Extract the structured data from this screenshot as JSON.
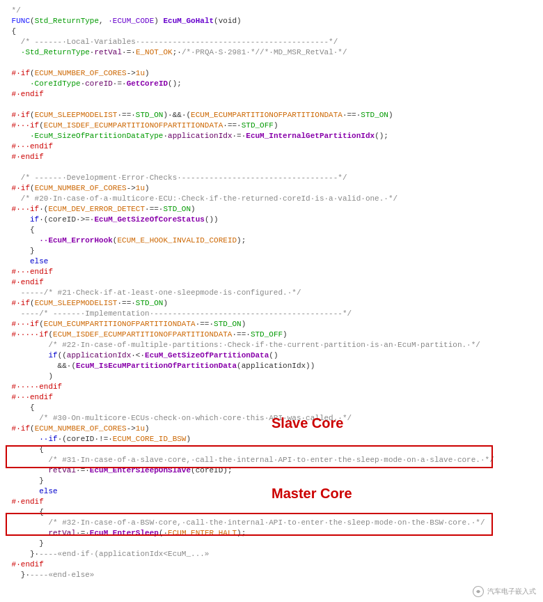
{
  "code": {
    "lines": [
      {
        "id": 1,
        "text": " */"
      },
      {
        "id": 2,
        "text": " FUNC(Std_ReturnType, ECUM_CODE) EcuM_GoHalt(void)"
      },
      {
        "id": 3,
        "text": " {"
      },
      {
        "id": 4,
        "text": "   /* ------ Local Variables ----------------------------------------*/"
      },
      {
        "id": 5,
        "text": "   Std_ReturnType retVal = E_NOT_OK; /*PRQA S 2981 *//*MD_MSR_RetVal */"
      },
      {
        "id": 6,
        "text": ""
      },
      {
        "id": 7,
        "text": " # if(ECUM_NUMBER_OF_CORES->1u)"
      },
      {
        "id": 8,
        "text": "     CoreIdType coreID = GetCoreID();"
      },
      {
        "id": 9,
        "text": " # endif"
      },
      {
        "id": 10,
        "text": ""
      },
      {
        "id": 11,
        "text": " # if(ECUM_SLEEPMODELIST == STD_ON) && (ECUM_ECUMPARTITIONOFPARTITIONDATA == STD_ON)"
      },
      {
        "id": 12,
        "text": " #   if(ECUM_ISDEF_ECUMPARTITIONOFPARTITIONDATA == STD_OFF)"
      },
      {
        "id": 13,
        "text": "       EcuM_SizeOfPartitionDataType applicationIdx = EcuM_InternalGetPartitionIdx();"
      },
      {
        "id": 14,
        "text": " #   endif"
      },
      {
        "id": 15,
        "text": " # endif"
      },
      {
        "id": 16,
        "text": ""
      },
      {
        "id": 17,
        "text": "   /* ------ Development Error Checks ---------------------------------*/"
      },
      {
        "id": 18,
        "text": " # if(ECUM_NUMBER_OF_CORES->1u)"
      },
      {
        "id": 19,
        "text": "   /* #20 In case of a multicore ECU: Check if the returned coreId is a valid one. */"
      },
      {
        "id": 20,
        "text": " #   if (ECUM_DEV_ERROR_DETECT == STD_ON)"
      },
      {
        "id": 21,
        "text": "     if (coreID >= EcuM_GetSizeOfCoreStatus())"
      },
      {
        "id": 22,
        "text": "     {"
      },
      {
        "id": 23,
        "text": "       EcuM_ErrorHook(ECUM_E_HOOK_INVALID_COREID);"
      },
      {
        "id": 24,
        "text": "     }"
      },
      {
        "id": 25,
        "text": "     else"
      },
      {
        "id": 26,
        "text": " #   endif"
      },
      {
        "id": 27,
        "text": " # endif"
      },
      {
        "id": 28,
        "text": "   -----/* #21 Check if at least one sleepmode is configured. */"
      },
      {
        "id": 29,
        "text": " # if(ECUM_SLEEPMODELIST == STD_ON)"
      },
      {
        "id": 30,
        "text": "   ----/* ------ Implementation -----------------------------------------*/"
      },
      {
        "id": 31,
        "text": " #   if(ECUM_ECUMPARTITIONOFPARTITIONDATA == STD_ON)"
      },
      {
        "id": 32,
        "text": " #     if(ECUM_ISDEF_ECUMPARTITIONOFPARTITIONDATA == STD_OFF)"
      },
      {
        "id": 33,
        "text": "         /* #22 In case of multiple partitions: Check if the current partition is an EcuM partition. */"
      },
      {
        "id": 34,
        "text": "         if((applicationIdx < EcuM_GetSizeOfPartitionData()"
      },
      {
        "id": 35,
        "text": "           && (EcuM_IsEcuMPartitionOfPartitionData(applicationIdx))"
      },
      {
        "id": 36,
        "text": "         )"
      },
      {
        "id": 37,
        "text": " #     endif"
      },
      {
        "id": 38,
        "text": " #   endif"
      },
      {
        "id": 39,
        "text": "     {"
      },
      {
        "id": 40,
        "text": "       /* #30 On multicore ECUs check on which core this API was called. */"
      },
      {
        "id": 41,
        "text": " # if(ECUM_NUMBER_OF_CORES->1u)"
      },
      {
        "id": 42,
        "text": "       if (coreID != ECUM_CORE_ID_BSW)"
      },
      {
        "id": 43,
        "text": "       {"
      },
      {
        "id": 44,
        "text": "         /* #31 In case of a slave core, call the internal API to enter the sleep mode on a slave core. */"
      },
      {
        "id": 45,
        "text": "         retVal = EcuM_EnterSleepOnSlave(coreID);"
      },
      {
        "id": 46,
        "text": "       }"
      },
      {
        "id": 47,
        "text": "       else"
      },
      {
        "id": 48,
        "text": " # endif"
      },
      {
        "id": 49,
        "text": "       {"
      },
      {
        "id": 50,
        "text": "         /* #32 In case of a BSW core, call the internal API to enter the sleep mode on the BSW core. */"
      },
      {
        "id": 51,
        "text": "         retVal = EcuM_EnterSleep( ECUM_ENTER_HALT);"
      },
      {
        "id": 52,
        "text": "       }"
      },
      {
        "id": 53,
        "text": "     } ---- «end if (applicationIdx<EcuM_...»"
      },
      {
        "id": 54,
        "text": " # endif"
      },
      {
        "id": 55,
        "text": "   } ----«end else»"
      }
    ],
    "slave_label": "Slave Core",
    "master_label": "Master Core",
    "watermark": "汽车电子嵌入式"
  }
}
